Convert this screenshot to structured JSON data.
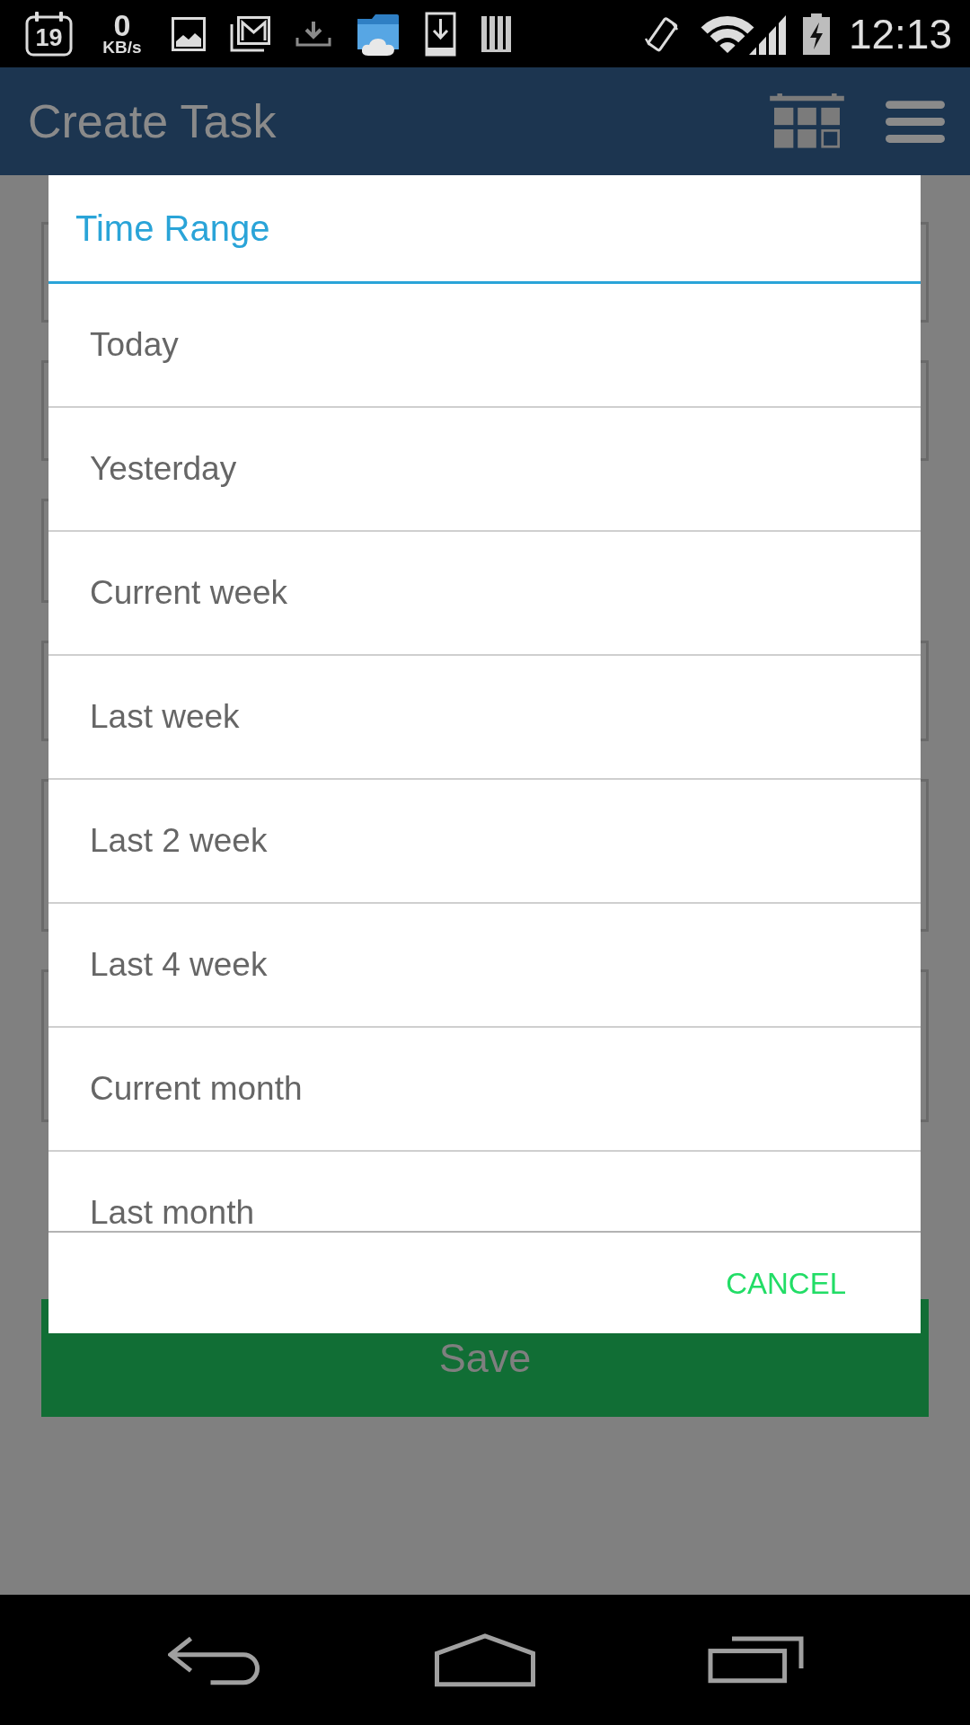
{
  "status_bar": {
    "calendar_date": "19",
    "net_speed": "0",
    "net_speed_unit": "KB/s",
    "time": "12:13"
  },
  "app_bar": {
    "title": "Create Task"
  },
  "form": {
    "fields": [
      {
        "kind": "text"
      },
      {
        "kind": "text"
      },
      {
        "kind": "select"
      },
      {
        "kind": "text"
      },
      {
        "kind": "multiline"
      },
      {
        "kind": "multiline"
      }
    ],
    "save_button": "Save"
  },
  "dialog": {
    "title": "Time Range",
    "options": [
      "Today",
      "Yesterday",
      "Current week",
      "Last week",
      "Last 2 week",
      "Last 4 week",
      "Current month",
      "Last month"
    ],
    "cancel_button": "CANCEL"
  }
}
